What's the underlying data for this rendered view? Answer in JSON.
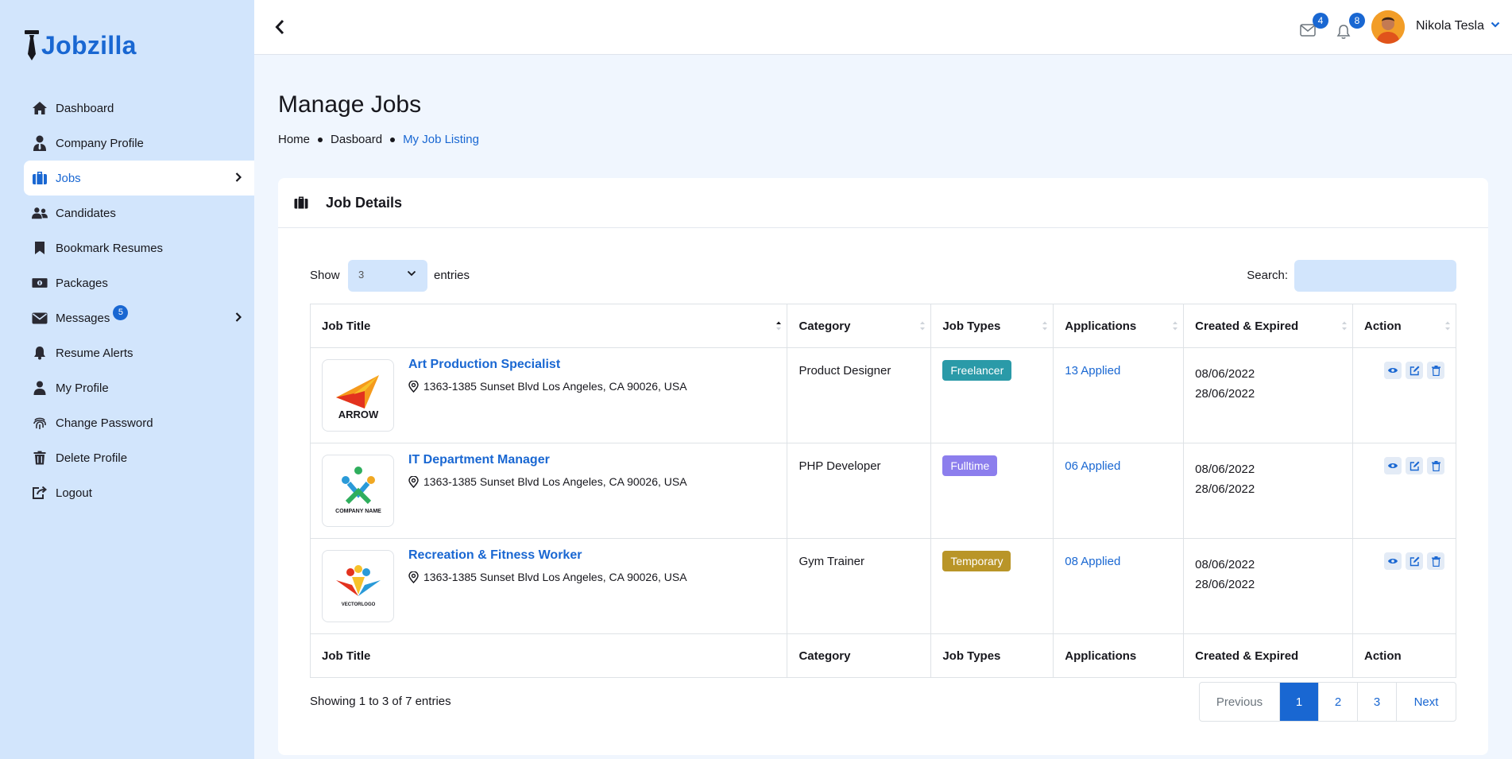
{
  "app": {
    "brand": "Jobzilla"
  },
  "sidebar": {
    "items": [
      {
        "label": "Dashboard",
        "icon": "home-icon"
      },
      {
        "label": "Company Profile",
        "icon": "user-tie-icon"
      },
      {
        "label": "Jobs",
        "icon": "briefcase-icon",
        "active": true,
        "has_submenu": true
      },
      {
        "label": "Candidates",
        "icon": "users-icon"
      },
      {
        "label": "Bookmark Resumes",
        "icon": "bookmark-icon"
      },
      {
        "label": "Packages",
        "icon": "money-icon"
      },
      {
        "label": "Messages",
        "icon": "envelope-icon",
        "badge": "5",
        "has_submenu": true
      },
      {
        "label": "Resume Alerts",
        "icon": "bell-icon"
      },
      {
        "label": "My Profile",
        "icon": "user-icon"
      },
      {
        "label": "Change Password",
        "icon": "fingerprint-icon"
      },
      {
        "label": "Delete Profile",
        "icon": "trash-icon"
      },
      {
        "label": "Logout",
        "icon": "logout-icon"
      }
    ]
  },
  "header": {
    "messages_count": "4",
    "notifications_count": "8",
    "user_name": "Nikola Tesla"
  },
  "page": {
    "title": "Manage Jobs",
    "breadcrumb": [
      "Home",
      "Dasboard",
      "My Job Listing"
    ]
  },
  "card": {
    "title": "Job Details",
    "show_label": "Show",
    "length_value": "3",
    "entries_label": "entries",
    "search_label": "Search:",
    "search_value": ""
  },
  "table": {
    "columns": [
      "Job Title",
      "Category",
      "Job Types",
      "Applications",
      "Created & Expired",
      "Action"
    ],
    "rows": [
      {
        "title": "Art Production Specialist",
        "location": "1363-1385 Sunset Blvd Los Angeles, CA 90026, USA",
        "logo_text": "ARROW",
        "category": "Product Designer",
        "type": "Freelancer",
        "type_color": "#2a9aa8",
        "applications": "13 Applied",
        "created": "08/06/2022",
        "expired": "28/06/2022"
      },
      {
        "title": "IT Department Manager",
        "location": "1363-1385 Sunset Blvd Los Angeles, CA 90026, USA",
        "logo_text": "COMPANY NAME",
        "category": "PHP Developer",
        "type": "Fulltime",
        "type_color": "#8c7eed",
        "applications": "06 Applied",
        "created": "08/06/2022",
        "expired": "28/06/2022"
      },
      {
        "title": "Recreation & Fitness Worker",
        "location": "1363-1385 Sunset Blvd Los Angeles, CA 90026, USA",
        "logo_text": "VECTORLOGO",
        "category": "Gym Trainer",
        "type": "Temporary",
        "type_color": "#b99528",
        "applications": "08 Applied",
        "created": "08/06/2022",
        "expired": "28/06/2022"
      }
    ]
  },
  "footer": {
    "info": "Showing 1 to 3 of 7 entries",
    "previous": "Previous",
    "pages": [
      "1",
      "2",
      "3"
    ],
    "next": "Next"
  },
  "colors": {
    "accent": "#1967d2",
    "sidebar_bg": "#d2e5fc",
    "page_bg": "#f0f6fe"
  }
}
